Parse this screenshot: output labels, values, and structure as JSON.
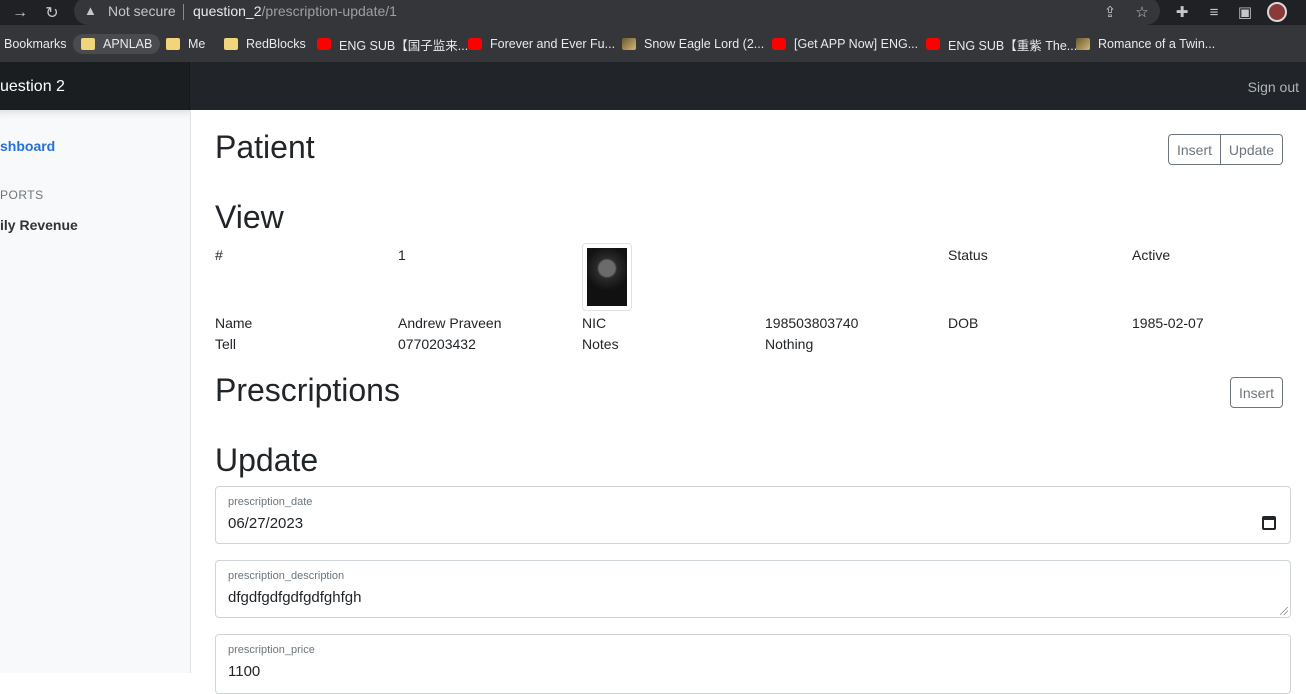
{
  "browser": {
    "not_secure": "Not secure",
    "url_host": "question_2",
    "url_path": "/prescription-update/1",
    "bookmarks": [
      {
        "label": "Bookmarks",
        "icon": "bookmarks-icon"
      },
      {
        "label": "APNLAB",
        "icon": "folder-icon"
      },
      {
        "label": "Me",
        "icon": "folder-icon"
      },
      {
        "label": "RedBlocks",
        "icon": "folder-icon"
      },
      {
        "label": "ENG SUB【国子监来...",
        "icon": "youtube-icon"
      },
      {
        "label": "Forever and Ever Fu...",
        "icon": "youtube-icon"
      },
      {
        "label": "Snow Eagle Lord (2...",
        "icon": "image-icon"
      },
      {
        "label": "[Get APP Now] ENG...",
        "icon": "youtube-icon"
      },
      {
        "label": "ENG SUB【重紫 The...",
        "icon": "youtube-icon"
      },
      {
        "label": "Romance of a Twin...",
        "icon": "image-icon"
      }
    ]
  },
  "navbar": {
    "brand": "uestion 2",
    "signout": "Sign out"
  },
  "sidebar": {
    "dashboard": "shboard",
    "reports_heading": "PORTS",
    "daily_revenue": "ily Revenue"
  },
  "patient": {
    "title": "Patient",
    "insert": "Insert",
    "update": "Update",
    "view_title": "View",
    "id_label": "#",
    "id_value": "1",
    "status_label": "Status",
    "status_value": "Active",
    "name_label": "Name",
    "name_value": "Andrew Praveen",
    "nic_label": "NIC",
    "nic_value": "198503803740",
    "dob_label": "DOB",
    "dob_value": "1985-02-07",
    "tell_label": "Tell",
    "tell_value": "0770203432",
    "notes_label": "Notes",
    "notes_value": "Nothing"
  },
  "prescriptions": {
    "title": "Prescriptions",
    "insert": "Insert",
    "update_title": "Update",
    "date_label": "prescription_date",
    "date_value": "06/27/2023",
    "description_label": "prescription_description",
    "description_value": "dfgdfgdfgdfgdfghfgh",
    "price_label": "prescription_price",
    "price_value": "1100"
  }
}
